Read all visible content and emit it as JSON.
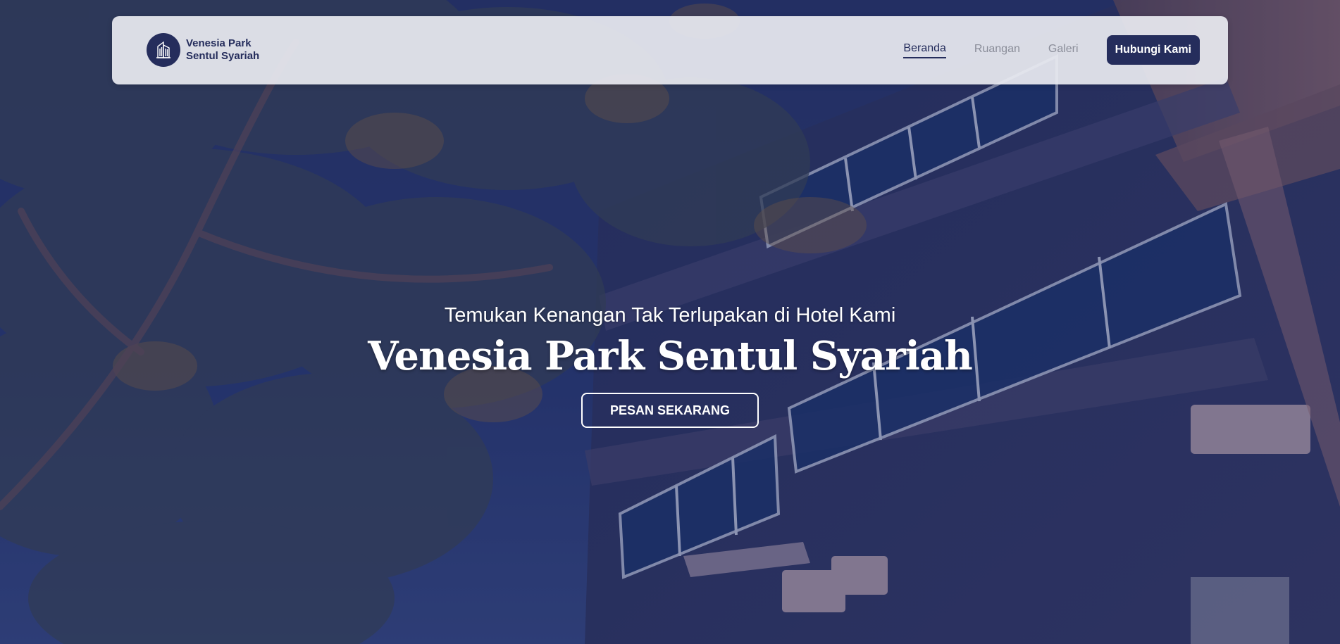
{
  "brand": {
    "name_line1": "Venesia Park",
    "name_line2": "Sentul Syariah",
    "logo_icon": "building-icon",
    "color": "#252d5c"
  },
  "nav": {
    "items": [
      {
        "label": "Beranda",
        "active": true
      },
      {
        "label": "Ruangan",
        "active": false
      },
      {
        "label": "Galeri",
        "active": false
      }
    ],
    "contact_label": "Hubungi Kami"
  },
  "hero": {
    "subtitle": "Temukan Kenangan Tak Terlupakan di Hotel Kami",
    "title": "Venesia Park Sentul Syariah",
    "cta_label": "PESAN SEKARANG",
    "background": "hotel building at dusk with trees"
  },
  "colors": {
    "primary": "#252d5c",
    "nav_inactive": "#8a8d99",
    "hero_text": "#ffffff"
  }
}
